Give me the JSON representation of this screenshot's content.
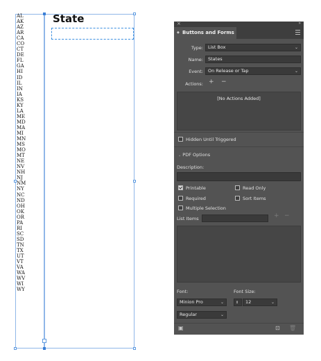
{
  "page": {
    "title": "State",
    "states": [
      "AL",
      "AK",
      "AZ",
      "AR",
      "CA",
      "CO",
      "CT",
      "DE",
      "FL",
      "GA",
      "HI",
      "ID",
      "IL",
      "IN",
      "IA",
      "KS",
      "KY",
      "LA",
      "ME",
      "MD",
      "MA",
      "MI",
      "MN",
      "MS",
      "MO",
      "MT",
      "NE",
      "NV",
      "NH",
      "NJ",
      "NM",
      "NY",
      "NC",
      "ND",
      "OH",
      "OK",
      "OR",
      "PA",
      "RI",
      "SC",
      "SD",
      "TN",
      "TX",
      "UT",
      "VT",
      "VA",
      "WA",
      "WV",
      "WI",
      "WY"
    ]
  },
  "panel": {
    "close_glyph": "×",
    "collapse_glyph": "»",
    "tab_label": "Buttons and Forms",
    "type_label": "Type:",
    "type_value": "List Box",
    "name_label": "Name:",
    "name_value": "States",
    "event_label": "Event:",
    "event_value": "On Release or Tap",
    "actions_label": "Actions:",
    "add_glyph": "+",
    "remove_glyph": "−",
    "no_actions": "[No Actions Added]",
    "hidden_label": "Hidden Until Triggered",
    "pdf_options_label": "PDF Options",
    "description_label": "Description:",
    "description_value": "",
    "printable_label": "Printable",
    "printable_checked": true,
    "read_only_label": "Read Only",
    "required_label": "Required",
    "sort_items_label": "Sort Items",
    "multiple_selection_label": "Multiple Selection",
    "list_items_label": "List Items",
    "list_items_value": "",
    "font_label": "Font:",
    "font_size_label": "Font Size:",
    "font_value": "Minion Pro",
    "font_size_value": "12",
    "font_style_value": "Regular"
  }
}
